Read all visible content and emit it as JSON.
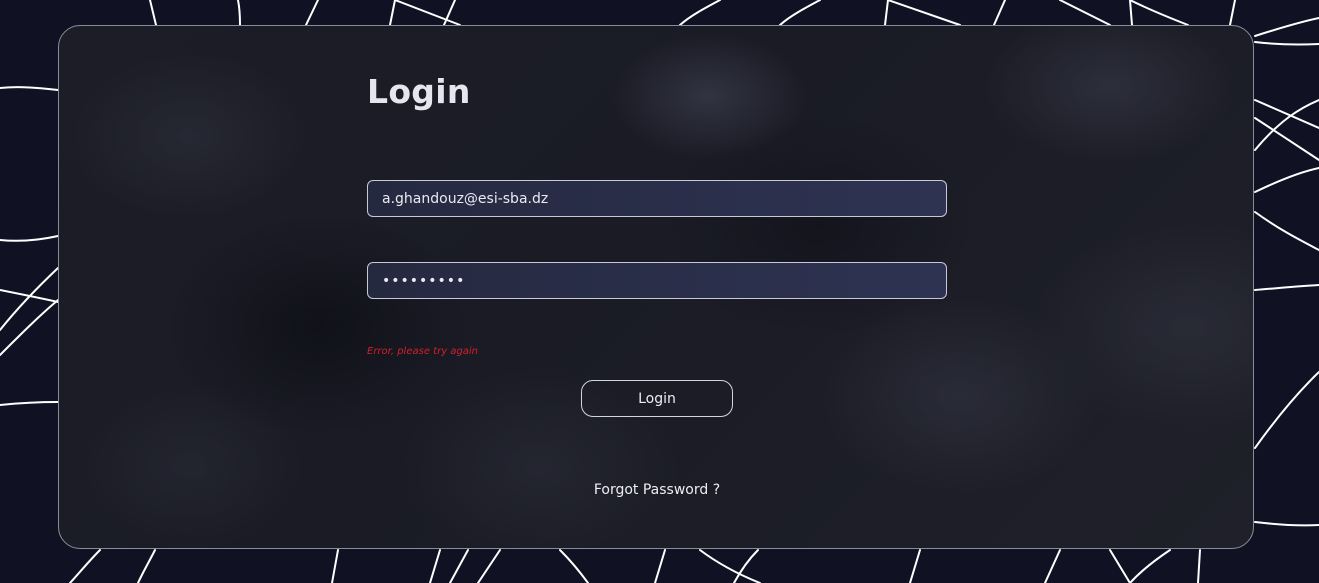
{
  "login_form": {
    "title": "Login",
    "email_value": "a.ghandouz@esi-sba.dz",
    "password_value": "•••••••••",
    "error_message": "Error, please try again",
    "submit_label": "Login",
    "forgot_password_label": "Forgot Password ?"
  },
  "colors": {
    "background": "#101224",
    "card": "#1c1d27",
    "input_fill": "#2a2e4a",
    "error": "#d21f2c",
    "text": "#e6e7ee"
  }
}
